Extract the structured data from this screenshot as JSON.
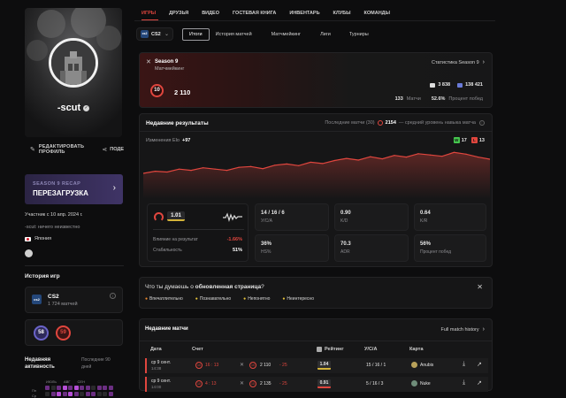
{
  "colors": {
    "accent": "#e0463e",
    "positive": "#45c64e",
    "negative": "#e0463e",
    "recap": "#3b2f5e"
  },
  "profile": {
    "name": "-scut",
    "edit_label": "РЕДАКТИРОВАТЬ ПРОФИЛЬ",
    "share_label": "ПОДЕ",
    "recap_top": "SEASON 9 RECAP",
    "recap_title": "ПЕРЕЗАГРУЗКА",
    "member_since": "Участник с 10 апр. 2024 г.",
    "bio": "-scut: ничего неизвестно",
    "country": "Япония"
  },
  "history": {
    "title": "История игр",
    "game": "CS2",
    "matches": "1 724 матчей",
    "levels": [
      "58",
      "59"
    ]
  },
  "activity": {
    "title_line1": "Недавняя",
    "title_line2": "активность",
    "period_line1": "Последние 90",
    "period_line2": "дней",
    "months": [
      "ИЮЛЬ",
      "АВГ",
      "СЕН"
    ],
    "days": [
      "Пн",
      "Ср"
    ]
  },
  "nav": {
    "tabs": [
      "ИГРЫ",
      "ДРУЗЬЯ",
      "ВИДЕО",
      "ГОСТЕВАЯ КНИГА",
      "ИНВЕНТАРЬ",
      "КЛУБЫ",
      "КОМАНДЫ"
    ]
  },
  "subnav": {
    "game": "CS2",
    "game_logo": "cs2",
    "tabs": [
      "Итоги",
      "История матчей",
      "Матчмейкинг",
      "Лиги",
      "Турниры"
    ]
  },
  "season": {
    "title": "Season 9",
    "subtitle": "Матчмейкинг",
    "stats_link": "Статистика Season 9",
    "level": "10",
    "elo": "2 110",
    "stat_a_value": "3 838",
    "stat_b_value": "138 421",
    "matches_value": "133",
    "matches_label": "Матчи",
    "win_value": "52.6%",
    "win_label": "Процент побед"
  },
  "recent": {
    "title": "Недавние результаты",
    "desc_prefix": "Последние матчи (30)",
    "desc_value": "2154",
    "desc_suffix": "— средний уровень навыка матча",
    "elo_change_label": "Изменения Elo",
    "elo_change_value": "+97",
    "wins": "17",
    "losses": "13",
    "rating": "1.01",
    "impact_label": "Влияние на результат",
    "impact_value": "-1.66%",
    "stability_label": "Стабильность",
    "stability_value": "51%",
    "stats": [
      {
        "value": "14 / 16 / 6",
        "label": "У/С/А"
      },
      {
        "value": "0.90",
        "label": "K/D"
      },
      {
        "value": "0.64",
        "label": "K/R"
      },
      {
        "value": "36%",
        "label": "HS%"
      },
      {
        "value": "70.3",
        "label": "ADR"
      },
      {
        "value": "56%",
        "label": "Процент побед"
      }
    ]
  },
  "chart_data": {
    "type": "area",
    "title": "Изменения Elo +97",
    "x": [
      1,
      2,
      3,
      4,
      5,
      6,
      7,
      8,
      9,
      10,
      11,
      12,
      13,
      14,
      15,
      16,
      17,
      18,
      19,
      20,
      21,
      22,
      23,
      24,
      25,
      26,
      27,
      28,
      29,
      30
    ],
    "values": [
      2020,
      2030,
      2026,
      2040,
      2034,
      2046,
      2040,
      2034,
      2048,
      2052,
      2042,
      2058,
      2064,
      2056,
      2072,
      2066,
      2080,
      2090,
      2082,
      2098,
      2088,
      2104,
      2096,
      2112,
      2106,
      2100,
      2118,
      2110,
      2096,
      2086
    ],
    "ylim": [
      1900,
      2140
    ],
    "grid": false,
    "legend": "none",
    "color": "#e0463e"
  },
  "feedback": {
    "question_prefix": "Что ты думаешь о ",
    "question_bold": "обновленная страница",
    "question_suffix": "?",
    "options": [
      "Впечатлительно",
      "Познавательно",
      "Непонятно",
      "Неинтересно"
    ]
  },
  "matches": {
    "title": "Недавние матчи",
    "history_link": "Full match history",
    "headers": [
      "Дата",
      "Счет",
      "Рейтинг",
      "У/С/А",
      "Карта"
    ],
    "rows": [
      {
        "date": "ср 9 сент.",
        "time": "14:38",
        "lvl": "10",
        "score": "16 : 13",
        "elo": "2 110",
        "diff": "- 25",
        "rating": "1.04",
        "kda": "15 / 16 / 1",
        "map": "Anubis"
      },
      {
        "date": "ср 9 сент.",
        "time": "14:00",
        "lvl": "10",
        "score": "4 : 13",
        "elo": "2 135",
        "diff": "- 25",
        "rating": "0.91",
        "kda": "5 / 16 / 3",
        "map": "Nuke"
      }
    ]
  }
}
